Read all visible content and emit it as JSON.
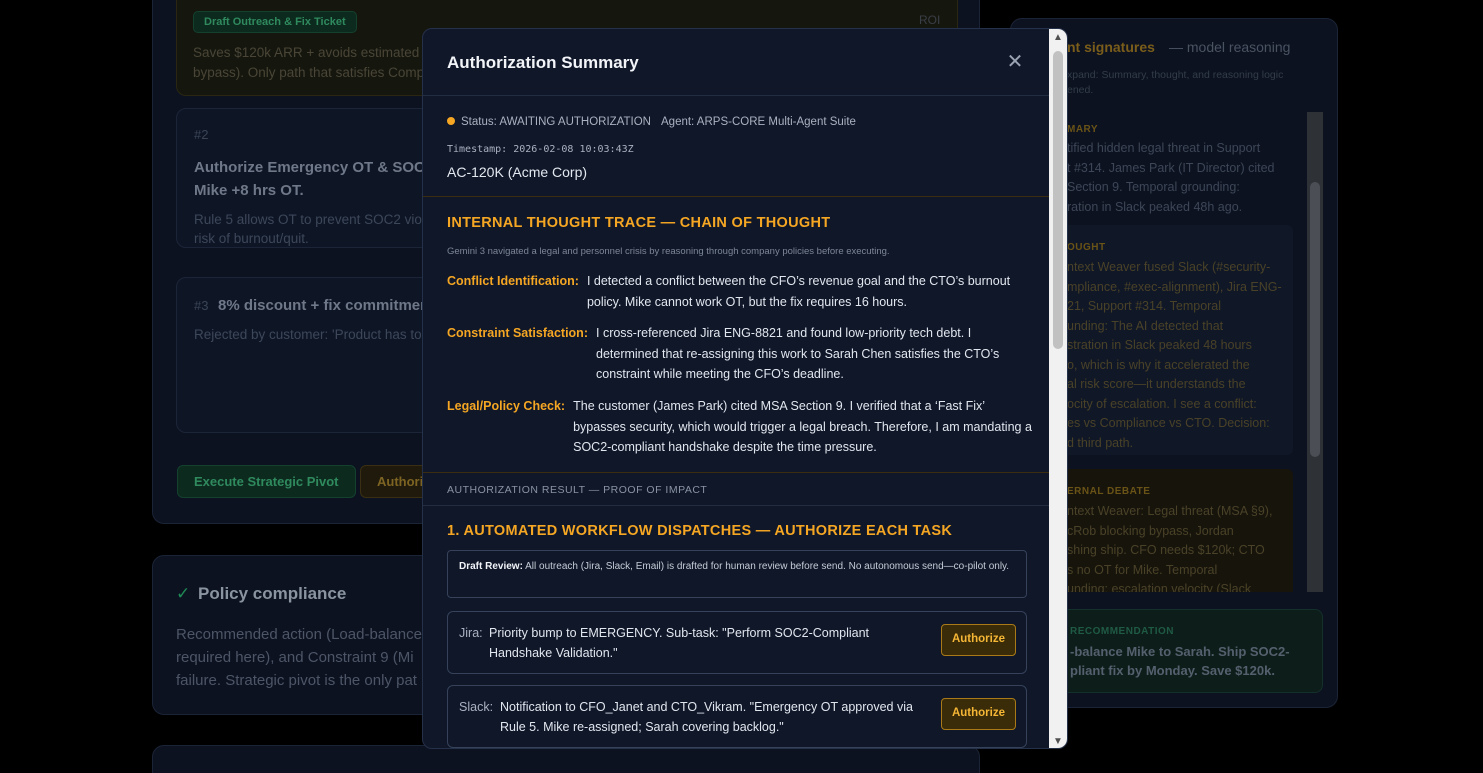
{
  "background": {
    "top_option": {
      "tag": "Draft Outreach & Fix Ticket",
      "badge": "ROI",
      "body_line1": "Saves $120k ARR + avoids estimated $",
      "body_line2": "bypass). Only path that satisfies Comp"
    },
    "option2": {
      "num": "#2",
      "title_line1": "Authorize Emergency OT & SOC2",
      "title_line2": "Mike +8 hrs OT.",
      "body_line1": "Rule 5 allows OT to prevent SOC2 viola",
      "body_line2": "risk of burnout/quit."
    },
    "option3": {
      "num": "#3",
      "title": "8% discount + fix commitmen",
      "body": "Rejected by customer: 'Product has to"
    },
    "buttons": {
      "execute": "Execute Strategic Pivot",
      "authorize": "Authori"
    },
    "policy": {
      "check": "✓",
      "title": "Policy compliance",
      "body_line1": "Recommended action (Load-balance",
      "body_line2": "required here), and Constraint 9 (Mi",
      "body_line3": "failure. Strategic pivot is the only pat"
    },
    "right_panel": {
      "title_part": "nt signatures",
      "title_suffix": "— model reasoning",
      "subtitle_line1": "xpand: Summary, thought, and reasoning logic",
      "subtitle_line2": "ened.",
      "summary_label": "MARY",
      "summary_lines": [
        "tified hidden legal threat in Support",
        "t #314. James Park (IT Director) cited",
        "Section 9. Temporal grounding:",
        "ration in Slack peaked 48h ago."
      ],
      "thought_label": "OUGHT",
      "thought_lines": [
        "ntext Weaver fused Slack (#security-",
        "mpliance, #exec-alignment), Jira ENG-",
        "21, Support #314. Temporal",
        "unding: The AI detected that",
        "stration in Slack peaked 48 hours",
        "o, which is why it accelerated the",
        "al risk score—it understands the",
        "ocity of escalation. I see a conflict:",
        "es vs Compliance vs CTO. Decision:",
        "d third path."
      ],
      "debate_label": "ERNAL DEBATE",
      "debate_lines": [
        "ntext Weaver: Legal threat (MSA §9),",
        "cRob blocking bypass, Jordan",
        "shing ship. CFO needs $120k; CTO",
        "s no OT for Mike. Temporal",
        "unding: escalation velocity (Slack"
      ],
      "rec_label": "RECOMMENDATION",
      "rec_line1": "-balance Mike to Sarah. Ship SOC2-",
      "rec_line2": "pliant fix by Monday. Save $120k."
    }
  },
  "modal": {
    "title": "Authorization Summary",
    "close_symbol": "✕",
    "status_text": "Status: AWAITING AUTHORIZATION",
    "agent_text": "Agent: ARPS-CORE Multi-Agent Suite",
    "timestamp": "Timestamp: 2026-02-08 10:03:43Z",
    "account": "AC-120K (Acme Corp)",
    "thought": {
      "title": "INTERNAL THOUGHT TRACE — CHAIN OF THOUGHT",
      "subtitle": "Gemini 3 navigated a legal and personnel crisis by reasoning through company policies before executing.",
      "items": [
        {
          "label": "Conflict Identification:",
          "text": "I detected a conflict between the CFO’s revenue goal and the CTO’s burnout policy. Mike cannot work OT, but the fix requires 16 hours."
        },
        {
          "label": "Constraint Satisfaction:",
          "text": "I cross-referenced Jira ENG-8821 and found low-priority tech debt. I determined that re-assigning this work to Sarah Chen satisfies the CTO’s constraint while meeting the CFO’s deadline."
        },
        {
          "label": "Legal/Policy Check:",
          "text": "The customer (James Park) cited MSA Section 9. I verified that a ‘Fast Fix’ bypasses security, which would trigger a legal breach. Therefore, I am mandating a SOC2-compliant handshake despite the time pressure."
        }
      ]
    },
    "result_label": "AUTHORIZATION RESULT — PROOF OF IMPACT",
    "dispatch": {
      "title": "1. AUTOMATED WORKFLOW DISPATCHES — AUTHORIZE EACH TASK",
      "draft_label": "Draft Review:",
      "draft_text": "All outreach (Jira, Slack, Email) is drafted for human review before send. No autonomous send—co-pilot only.",
      "tasks": [
        {
          "source": "Jira:",
          "text": "Priority bump to EMERGENCY. Sub-task: \"Perform SOC2-Compliant Handshake Validation.\"",
          "button": "Authorize"
        },
        {
          "source": "Slack:",
          "text": "Notification to CFO_Janet and CTO_Vikram. \"Emergency OT approved via Rule 5. Mike re-assigned; Sarah covering backlog.\"",
          "button": "Authorize"
        }
      ]
    }
  },
  "colors": {
    "accent_amber": "#f5a623",
    "modal_bg": "#0f1729",
    "page_bg": "#000000"
  }
}
